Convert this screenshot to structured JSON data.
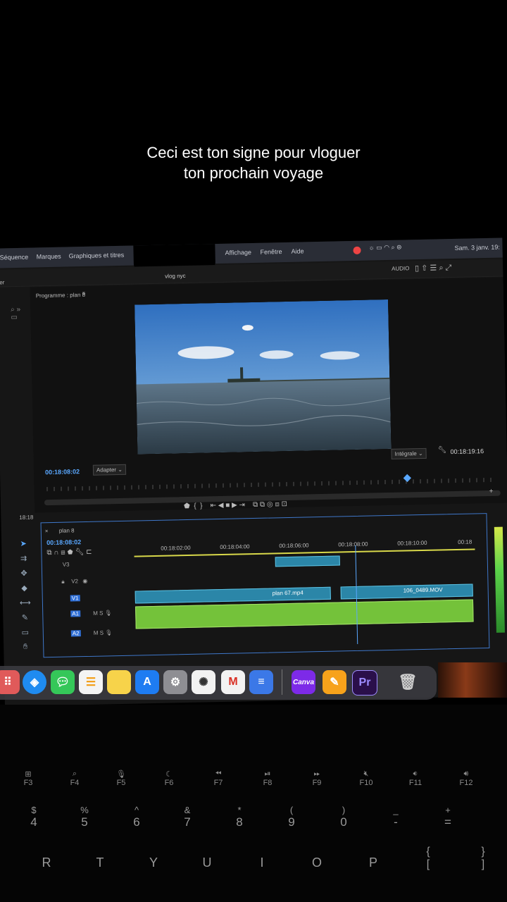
{
  "caption": {
    "line1": "Ceci est ton signe pour vloguer",
    "line2": "ton prochain voyage"
  },
  "menubar": {
    "items_left": [
      "Séquence",
      "Marques",
      "Graphiques et titres"
    ],
    "items_right": [
      "Affichage",
      "Fenêtre",
      "Aide"
    ],
    "clock": "Sam. 3 janv. 19:"
  },
  "app": {
    "left_label": "rter",
    "title": "vlog nyc",
    "audio_label": "AUDIO"
  },
  "program": {
    "panel_title": "Programme : plan 8",
    "current_time": "00:18:08:02",
    "fit_select": "Adapter",
    "quality_select": "Intégrale",
    "duration": "00:18:19:16"
  },
  "timeline": {
    "sequence_name": "plan 8",
    "current_time": "00:18:08:02",
    "ruler": [
      "00:18:02:00",
      "00:18:04:00",
      "00:18:06:00",
      "00:18:08:00",
      "00:18:10:00",
      "00:18"
    ],
    "tracks": {
      "v3": "V3",
      "v2": "V2",
      "v1": "V1",
      "a1": "A1",
      "a2": "A2"
    },
    "clips": {
      "clip1": "plan 67.mp4",
      "clip2": "106_0489.MOV"
    },
    "side_label": "18:18"
  },
  "dock": {
    "apps": [
      "Launchpad",
      "Safari",
      "Messages",
      "Reminders",
      "Notes",
      "App Store",
      "System Settings",
      "ChatGPT",
      "Gmail",
      "Docs",
      "Canva",
      "Pages",
      "Premiere Pro",
      "Trash"
    ],
    "canva_label": "Canva",
    "pr_label": "Pr"
  },
  "keyboard": {
    "fn_row": [
      "F3",
      "F4",
      "F5",
      "F6",
      "F7",
      "F8",
      "F9",
      "F10",
      "F11",
      "F12"
    ],
    "num_top": [
      "$",
      "%",
      "^",
      "&",
      "*",
      "(",
      ")",
      "_",
      "+"
    ],
    "num_bottom": [
      "4",
      "5",
      "6",
      "7",
      "8",
      "9",
      "0",
      "-",
      "="
    ],
    "letters": [
      "R",
      "T",
      "Y",
      "U",
      "I",
      "O",
      "P"
    ],
    "brackets_top": [
      "{",
      "}"
    ],
    "brackets_bottom": [
      "[",
      "]"
    ]
  }
}
